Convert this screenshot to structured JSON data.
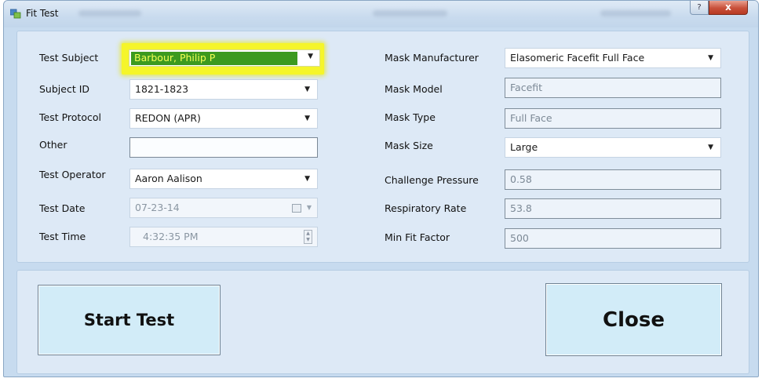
{
  "window": {
    "title": "Fit Test",
    "help_label": "?",
    "close_label": "x"
  },
  "form": {
    "test_subject": {
      "label": "Test Subject",
      "value": "Barbour, Philip P"
    },
    "subject_id": {
      "label": "Subject ID",
      "value": "1821-1823"
    },
    "test_protocol": {
      "label": "Test Protocol",
      "value": "REDON (APR)"
    },
    "other": {
      "label": "Other",
      "value": ""
    },
    "test_operator": {
      "label": "Test Operator",
      "value": "Aaron Aalison"
    },
    "test_date": {
      "label": "Test Date",
      "value": "07-23-14"
    },
    "test_time": {
      "label": "Test Time",
      "value": "4:32:35 PM"
    },
    "mask_manufacturer": {
      "label": "Mask Manufacturer",
      "value": "Elasomeric Facefit Full Face"
    },
    "mask_model": {
      "label": "Mask Model",
      "value": "Facefit"
    },
    "mask_type": {
      "label": "Mask Type",
      "value": "Full Face"
    },
    "mask_size": {
      "label": "Mask Size",
      "value": "Large"
    },
    "challenge_pressure": {
      "label": "Challenge Pressure",
      "value": "0.58"
    },
    "respiratory_rate": {
      "label": "Respiratory Rate",
      "value": "53.8"
    },
    "min_fit_factor": {
      "label": "Min Fit Factor",
      "value": "500"
    }
  },
  "buttons": {
    "start_test": "Start Test",
    "close": "Close"
  },
  "colors": {
    "highlight": "#f5f52a",
    "selection": "#3c9a1f",
    "button_fill": "#d2ecf8",
    "window_bg": "#c7dbef"
  }
}
